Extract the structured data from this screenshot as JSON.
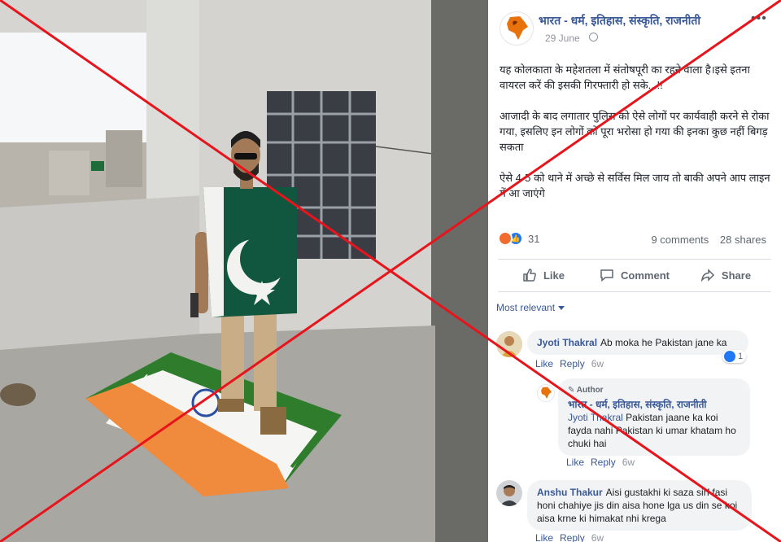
{
  "post": {
    "page_name": "भारत - धर्म, इतिहास, संस्कृति, राजनीती",
    "date": "29 June",
    "more_icon": "ellipsis-icon",
    "body": [
      "यह कोलकाता के महेशतला में संतोषपूरी का रहने वाला है।इसे इतना वायरल करें की इसकी गिरफ्तारी हो सके...!!",
      "आजादी के बाद लगातार पुलिस को ऐसे लोगों पर कार्यवाही करने से रोका गया, इसलिए इन लोगों को पूरा भरोसा हो गया की इनका कुछ नहीं बिगड़ सकता",
      "ऐसे 4-5 को थाने में अच्छे से सर्विस मिल जाय तो बाकी अपने आप लाइन में आ जाएंगे"
    ],
    "reaction_count": "31",
    "comments_count": "9 comments",
    "shares_count": "28 shares",
    "actions": {
      "like": "Like",
      "comment": "Comment",
      "share": "Share"
    },
    "sort_label": "Most relevant"
  },
  "comments": [
    {
      "author": "Jyoti Thakral",
      "text": "Ab moka he Pakistan jane ka",
      "like": "Like",
      "reply": "Reply",
      "time": "6w",
      "likes": "1"
    },
    {
      "author_tag": "Author",
      "author": "भारत - धर्म, इतिहास, संस्कृति, राजनीती",
      "mention": "Jyoti Thakral",
      "text": "Pakistan jaane ka koi fayda nahi Pakistan ki umar khatam ho chuki hai",
      "like": "Like",
      "reply": "Reply",
      "time": "6w"
    },
    {
      "author": "Anshu Thakur",
      "text": "Aisi gustakhi ki saza sirf fasi honi chahiye jis din aisa hone lga us din se koi aisa krne ki himakat nhi krega",
      "like": "Like",
      "reply": "Reply",
      "time": "6w"
    }
  ],
  "colors": {
    "link_blue": "#385898",
    "text_dark": "#1d2129",
    "muted": "#90949c",
    "cross_red": "#e8141c",
    "pak_green": "#115740",
    "saffron": "#f08a3c",
    "india_green": "#2f7d2c"
  }
}
